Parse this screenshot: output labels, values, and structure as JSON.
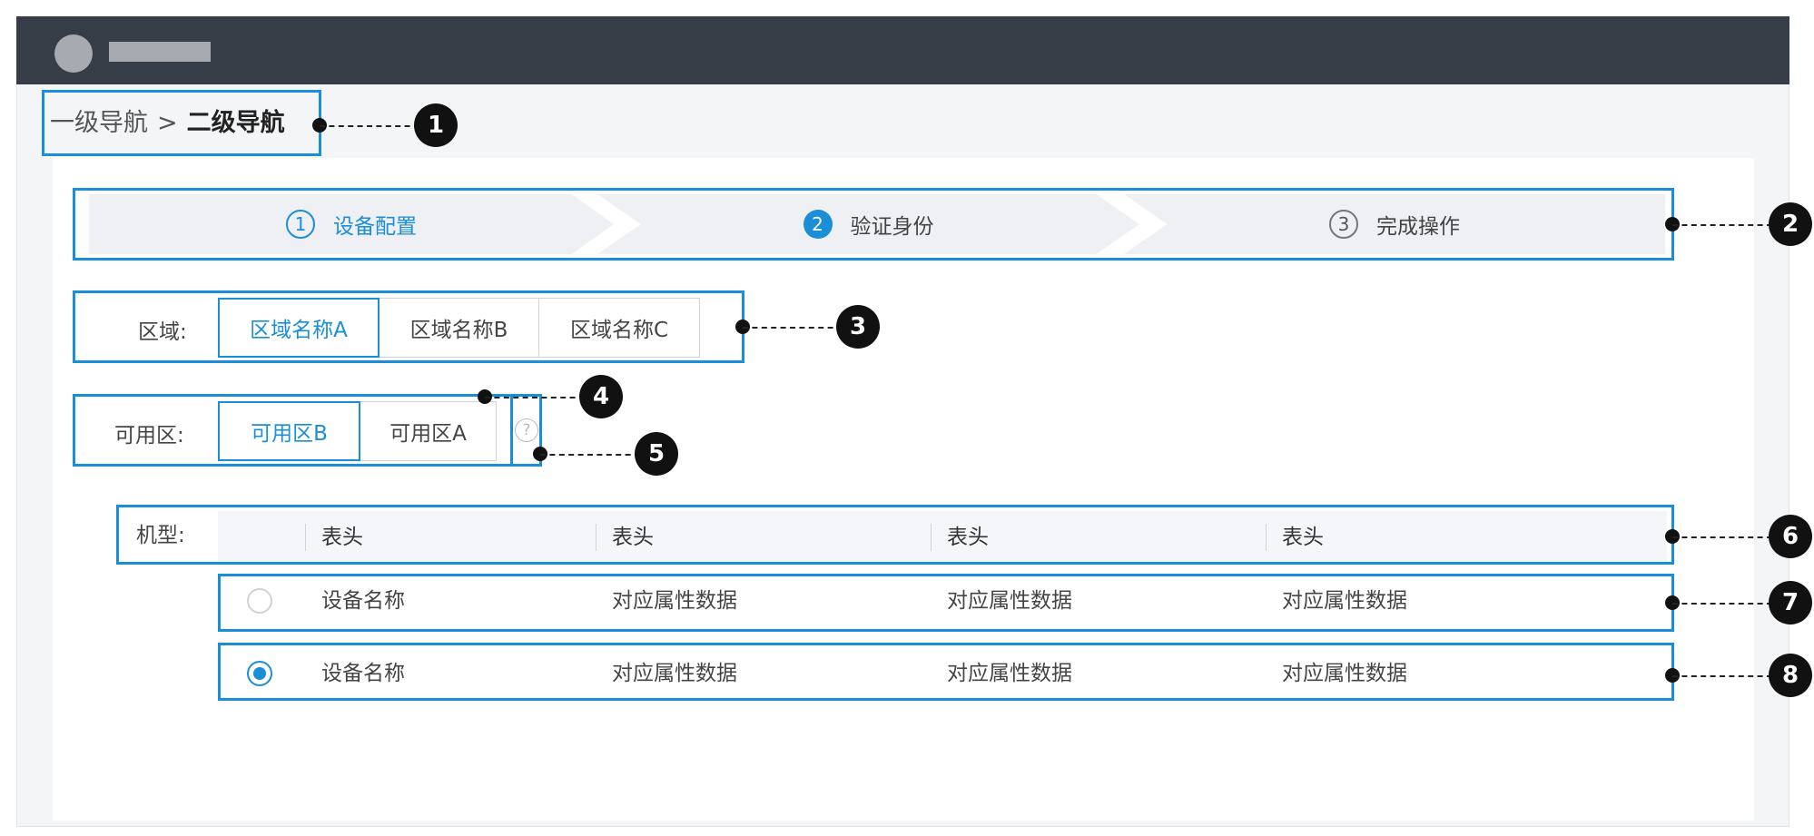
{
  "breadcrumb": {
    "level1": "一级导航",
    "separator": ">",
    "level2": "二级导航"
  },
  "steps": [
    {
      "num": "1",
      "label": "设备配置"
    },
    {
      "num": "2",
      "label": "验证身份"
    },
    {
      "num": "3",
      "label": "完成操作"
    }
  ],
  "region": {
    "label": "区域:",
    "options": [
      "区域名称A",
      "区域名称B",
      "区域名称C"
    ],
    "selected": "区域名称A"
  },
  "zone": {
    "label": "可用区:",
    "options": [
      "可用区B",
      "可用区A"
    ],
    "selected": "可用区B",
    "help_glyph": "?"
  },
  "model": {
    "label": "机型:",
    "headers": [
      "表头",
      "表头",
      "表头",
      "表头"
    ],
    "rows": [
      {
        "selected": false,
        "cells": [
          "设备名称",
          "对应属性数据",
          "对应属性数据",
          "对应属性数据"
        ]
      },
      {
        "selected": true,
        "cells": [
          "设备名称",
          "对应属性数据",
          "对应属性数据",
          "对应属性数据"
        ]
      }
    ]
  },
  "annotations": [
    "1",
    "2",
    "3",
    "4",
    "5",
    "6",
    "7",
    "8"
  ],
  "colors": {
    "accent": "#1b8ed8",
    "topbar": "#363d46",
    "annotation": "#111111",
    "step_bg": "#eef0f4"
  }
}
